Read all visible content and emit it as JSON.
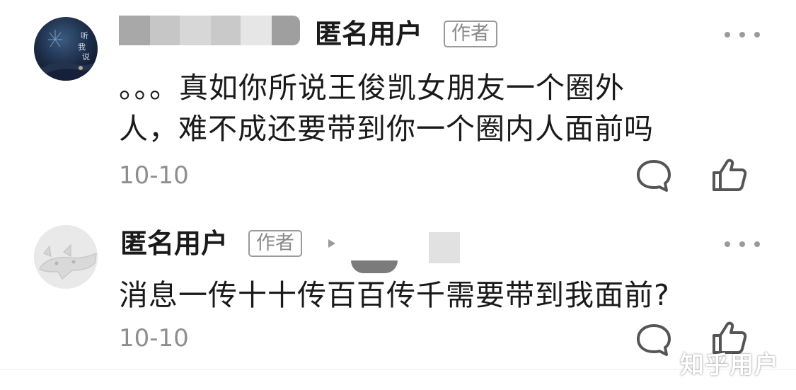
{
  "comments": [
    {
      "user": "匿名用户",
      "tag": "作者",
      "avatar_art_text": "听我说",
      "text_line1": "。。。真如你所说王俊凯女朋友一个圈外",
      "text_line2": "人，难不成还要带到你一个圈内人面前吗",
      "date": "10-10"
    },
    {
      "user": "匿名用户",
      "tag": "作者",
      "text": "消息一传十十传百百传千需要带到我面前?",
      "date": "10-10"
    }
  ],
  "icons": {
    "more": "more-dots-icon",
    "reply": "comment-bubble-icon",
    "like": "thumbs-up-icon",
    "reply_arrow": "triangle-right-icon"
  },
  "colors": {
    "text": "#1a1a1a",
    "muted": "#8e8e8e",
    "tag_border": "#9a9a9a"
  },
  "watermark": "知乎用户"
}
